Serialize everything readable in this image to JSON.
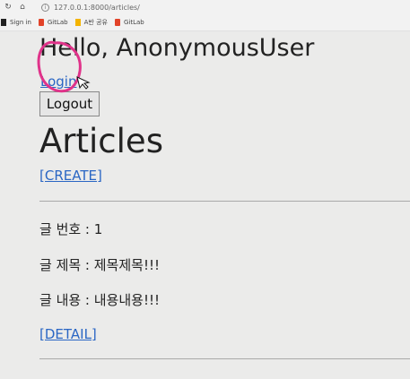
{
  "browser": {
    "url": "127.0.0.1:8000/articles/",
    "bookmarks": [
      {
        "label": "Sign in"
      },
      {
        "label": "GitLab"
      },
      {
        "label": "A반 공유"
      },
      {
        "label": "GitLab"
      }
    ]
  },
  "page": {
    "greeting": "Hello, AnonymousUser",
    "login_label": "Login",
    "logout_label": "Logout",
    "title": "Articles",
    "create_label": "[CREATE]"
  },
  "article": {
    "number_line": "글 번호 : 1",
    "title_line": "글 제목 : 제목제목!!!",
    "content_line": "글 내용 : 내용내용!!!",
    "detail_label": "[DETAIL]"
  },
  "colors": {
    "link": "#2a66c4",
    "annotation": "#e0338a"
  }
}
